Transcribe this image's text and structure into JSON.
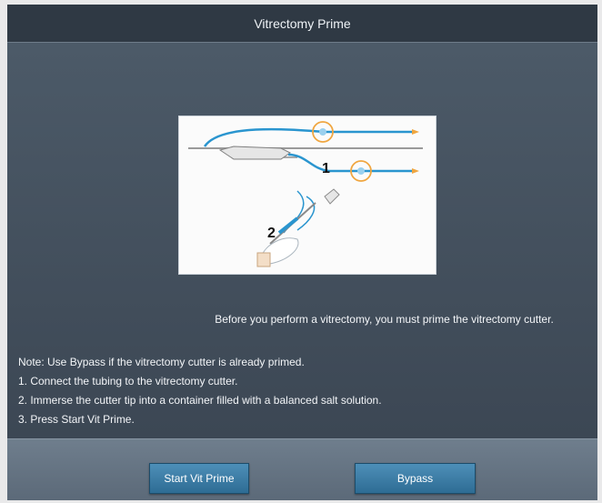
{
  "window": {
    "title": "Vitrectomy Prime"
  },
  "illustration": {
    "step1_label": "1",
    "step2_label": "2"
  },
  "intro_text": "Before you perform a vitrectomy, you must prime the vitrectomy cutter.",
  "notes": [
    "Note: Use Bypass if the vitrectomy cutter is already primed.",
    "1. Connect the tubing to the vitrectomy cutter.",
    "2. Immerse the cutter tip into a container filled with a balanced salt solution.",
    "3. Press Start Vit Prime."
  ],
  "buttons": {
    "start_label": "Start Vit Prime",
    "bypass_label": "Bypass"
  },
  "colors": {
    "tubing": "#2a95cf",
    "connector": "#f0a640"
  }
}
